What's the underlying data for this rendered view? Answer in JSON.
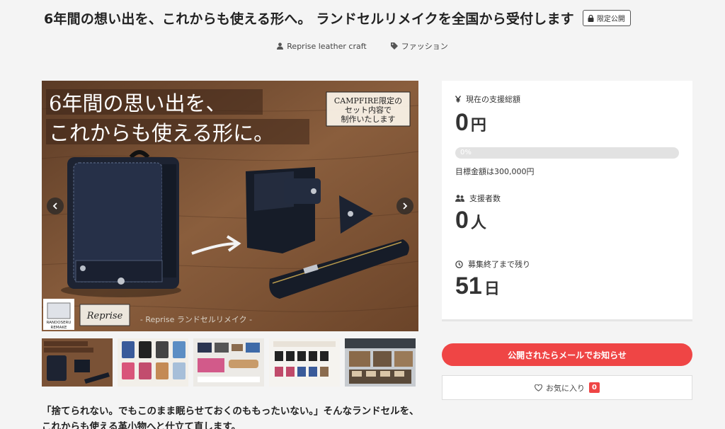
{
  "project": {
    "title": "6年間の想い出を、これからも使える形へ。 ランドセルリメイクを全国から受付します",
    "badge": "限定公開",
    "owner": "Reprise leather craft",
    "category": "ファッション",
    "intro_line1": "「捨てられない。でもこのまま眠らせておくのももったいない。」そんなランドセルを、",
    "intro_line2": "これからも使える革小物へと仕立て直します。"
  },
  "hero": {
    "headline_line1": "6年間の思い出を、",
    "headline_line2": "これからも使える形に。",
    "campfire_line1": "CAMPFIRE限定の",
    "campfire_line2": "セット内容で",
    "campfire_line3": "制作いたします",
    "logo_line1": "RANDOSERU",
    "logo_line2": "REMAKE",
    "brand": "Reprise",
    "footer": "- Reprise ランドセルリメイク -"
  },
  "stats": {
    "total_label": "現在の支援総額",
    "total_value": "0",
    "total_unit": "円",
    "progress_label": "0%",
    "progress_fraction": 0,
    "goal": "目標金額は300,000円",
    "backers_label": "支援者数",
    "backers_value": "0",
    "backers_unit": "人",
    "remaining_label": "募集終了まで残り",
    "remaining_value": "51",
    "remaining_unit": "日"
  },
  "actions": {
    "notify": "公開されたらメールでお知らせ",
    "favorite": "お気に入り",
    "favorite_count": "0"
  },
  "colors": {
    "accent": "#ef4545",
    "wood": "#7a5236",
    "bag": "#1d2332"
  }
}
